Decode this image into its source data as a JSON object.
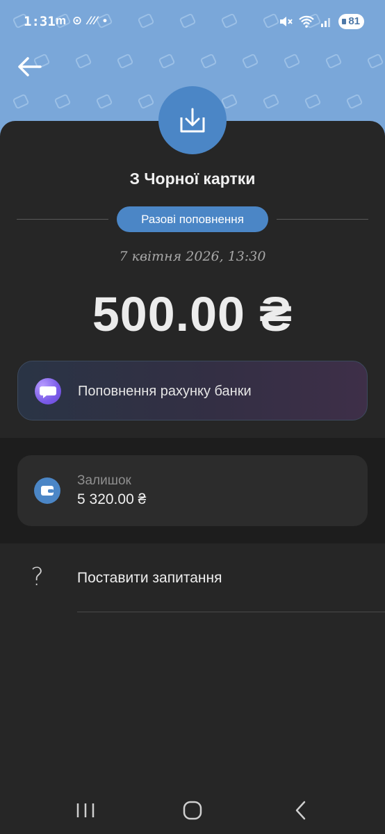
{
  "status_bar": {
    "time": "1:31",
    "left_icons": "m ⊙ ⁄⁄⁄ •",
    "battery": "81"
  },
  "header": {
    "back_icon": "arrow-left-icon"
  },
  "transaction": {
    "title": "З Чорної картки",
    "category_pill": "Разові поповнення",
    "date": "7 квітня 2026, 13:30",
    "amount": "500.00 ₴",
    "comment": "Поповнення рахунку банки"
  },
  "balance": {
    "label": "Залишок",
    "value": "5 320.00 ₴"
  },
  "actions": {
    "ask_question": "Поставити запитання"
  },
  "colors": {
    "header_bg": "#7aa7d9",
    "accent": "#4b86c6",
    "card_bg": "#262626"
  }
}
